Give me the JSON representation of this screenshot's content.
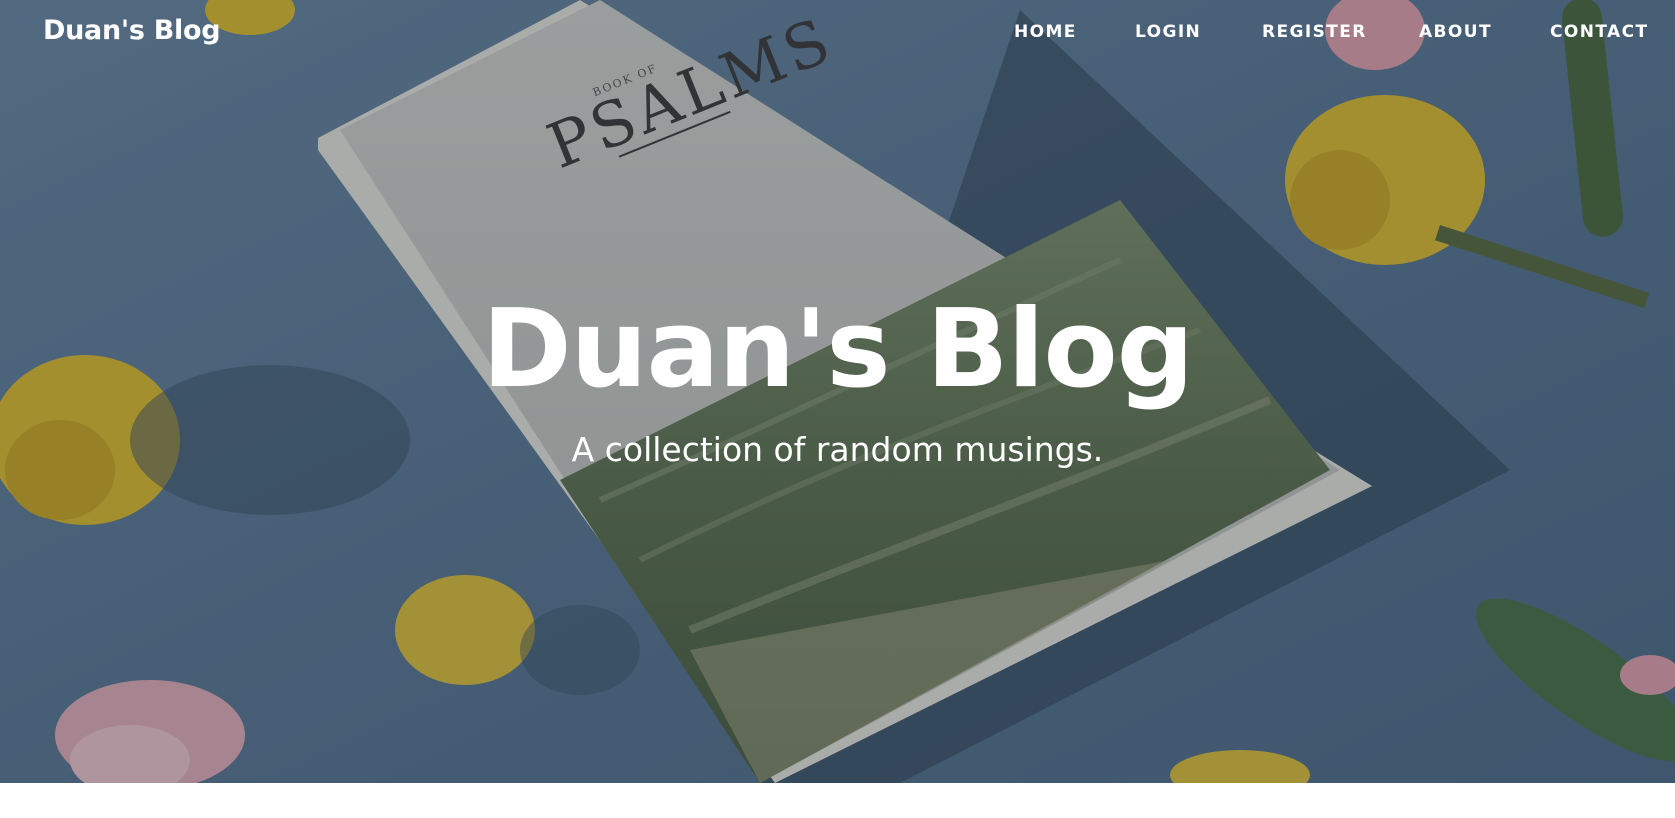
{
  "navbar": {
    "brand": "Duan's Blog",
    "links": [
      {
        "label": "HOME"
      },
      {
        "label": "LOGIN"
      },
      {
        "label": "REGISTER"
      },
      {
        "label": "ABOUT"
      },
      {
        "label": "CONTACT"
      }
    ]
  },
  "hero": {
    "title": "Duan's Blog",
    "subtitle": "A collection of random musings.",
    "background_colors": {
      "backdrop": "#5c7b97",
      "book_cover": "#c6c7c2",
      "hills": "#5f7456",
      "flower_yellow": "#e2bf2e",
      "flower_pink": "#e7a4b0"
    },
    "book_cover_text": {
      "small": "BOOK OF",
      "large": "PSALMS"
    }
  }
}
